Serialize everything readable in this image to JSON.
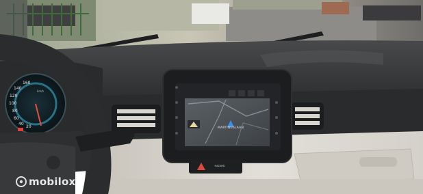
{
  "photo": {
    "description_free": true,
    "watermark": {
      "text": "mobilox",
      "icon": "mobilox-logo-icon"
    },
    "speedometer": {
      "ticks": [
        "160",
        "140",
        "120",
        "100",
        "80",
        "60",
        "40",
        "20"
      ],
      "unit": "km/h"
    },
    "infotainment": {
      "map_label": "MARTINUSLAAN",
      "icons": [
        "navigation-arrow-icon",
        "home-icon",
        "phone-icon",
        "settings-icon"
      ]
    },
    "hazard_switch": {
      "label": "HAZARD"
    },
    "colors": {
      "dashboard": "#3b3c3e",
      "trim": "#d9d6cf",
      "screen_frame": "#1c1d1f",
      "map": "#4d5257",
      "sky_glare": "#f5f5f2"
    }
  }
}
